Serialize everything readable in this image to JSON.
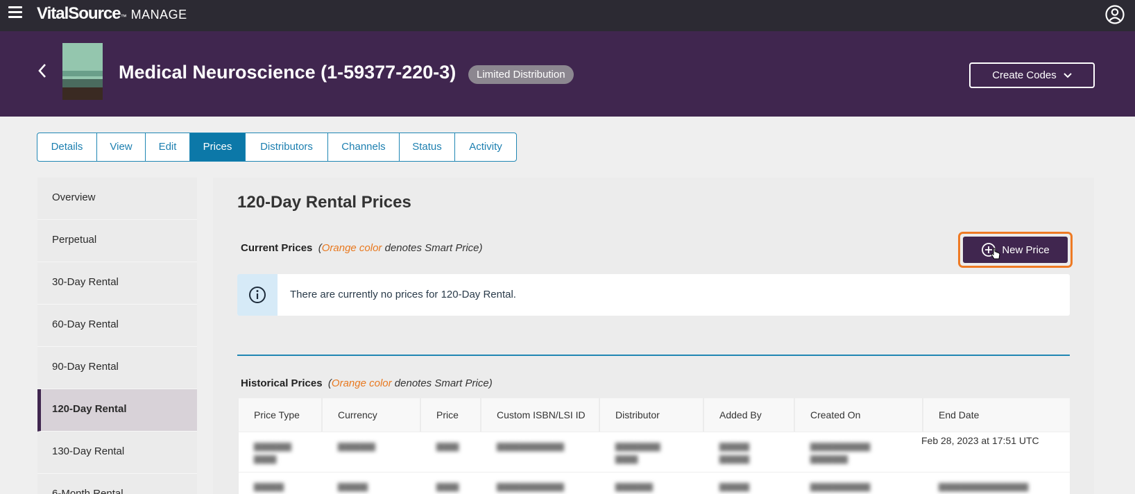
{
  "app": {
    "brand": "VitalSource",
    "product": "MANAGE",
    "icons": {
      "menu": "hamburger-menu-icon",
      "account": "account-circle-icon"
    }
  },
  "header": {
    "title": "Medical Neuroscience (1-59377-220-3)",
    "badge": "Limited Distribution",
    "create_codes": "Create Codes"
  },
  "tabs": [
    {
      "label": "Details"
    },
    {
      "label": "View"
    },
    {
      "label": "Edit"
    },
    {
      "label": "Prices",
      "active": true
    },
    {
      "label": "Distributors"
    },
    {
      "label": "Channels"
    },
    {
      "label": "Status"
    },
    {
      "label": "Activity"
    }
  ],
  "sidebar": {
    "items": [
      {
        "label": "Overview"
      },
      {
        "label": "Perpetual"
      },
      {
        "label": "30-Day Rental"
      },
      {
        "label": "60-Day Rental"
      },
      {
        "label": "90-Day Rental"
      },
      {
        "label": "120-Day Rental",
        "active": true
      },
      {
        "label": "130-Day Rental"
      },
      {
        "label": "6-Month Rental"
      }
    ]
  },
  "main": {
    "title": "120-Day Rental Prices",
    "current_label": "Current Prices",
    "orange_label": "Orange color",
    "smart_label": "denotes Smart Price)",
    "open_paren": "(",
    "new_price": "New Price",
    "info_text": "There are currently no prices for 120-Day Rental.",
    "historical_label": "Historical Prices",
    "table": {
      "headers": [
        "Price Type",
        "Currency",
        "Price",
        "Custom ISBN/LSI ID",
        "Distributor",
        "Added By",
        "Created On",
        "End Date"
      ],
      "visible_end_date": "Feb 28, 2023 at 17:51 UTC"
    }
  },
  "colors": {
    "topbar": "#2c2a33",
    "header": "#40264f",
    "tab_active": "#0c78a8",
    "highlight": "#ee7a24",
    "smart_price": "#e8781e"
  }
}
